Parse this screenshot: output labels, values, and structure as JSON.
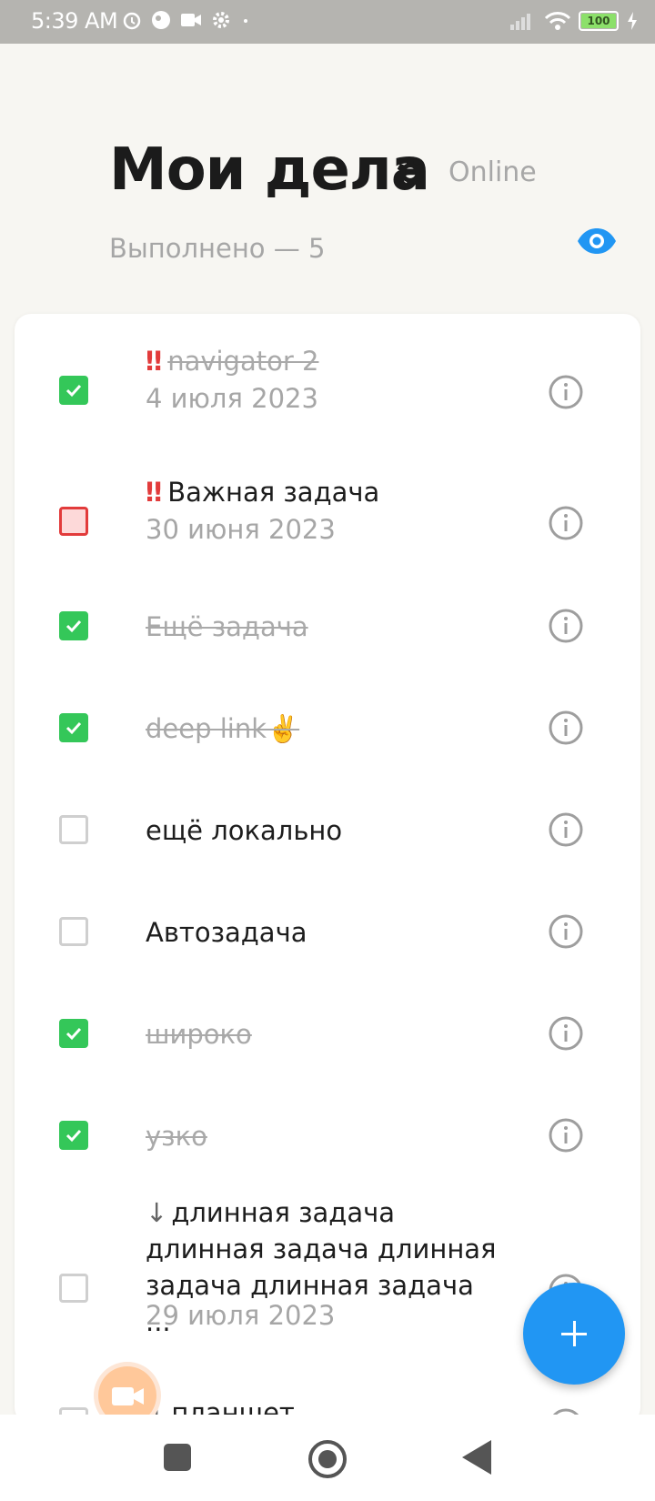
{
  "status_bar": {
    "time": "5:39 AM",
    "battery": "100"
  },
  "header": {
    "title": "Мои дела",
    "status": "Online",
    "completed": "Выполнено — 5"
  },
  "colors": {
    "accent": "#2196f3",
    "done": "#34c759",
    "important": "#e23b3b"
  },
  "tasks": [
    {
      "text": "navigator 2",
      "date": "4 июля 2023",
      "checked": true,
      "priority": "high"
    },
    {
      "text": "Важная задача",
      "date": "30 июня 2023",
      "checked": false,
      "priority": "high"
    },
    {
      "text": "Ещё задача",
      "date": "",
      "checked": true,
      "priority": "normal"
    },
    {
      "text": "deep link✌️",
      "date": "",
      "checked": true,
      "priority": "normal"
    },
    {
      "text": "ещё локально",
      "date": "",
      "checked": false,
      "priority": "normal"
    },
    {
      "text": "Автозадача",
      "date": "",
      "checked": false,
      "priority": "normal"
    },
    {
      "text": "широко",
      "date": "",
      "checked": true,
      "priority": "normal"
    },
    {
      "text": "узко",
      "date": "",
      "checked": true,
      "priority": "normal"
    },
    {
      "text": "длинная задача длинная задача длинная задача длинная задача ...",
      "date": "29 июля 2023",
      "checked": false,
      "priority": "low"
    },
    {
      "text": "планшет",
      "date": "",
      "checked": false,
      "priority": "low"
    }
  ]
}
